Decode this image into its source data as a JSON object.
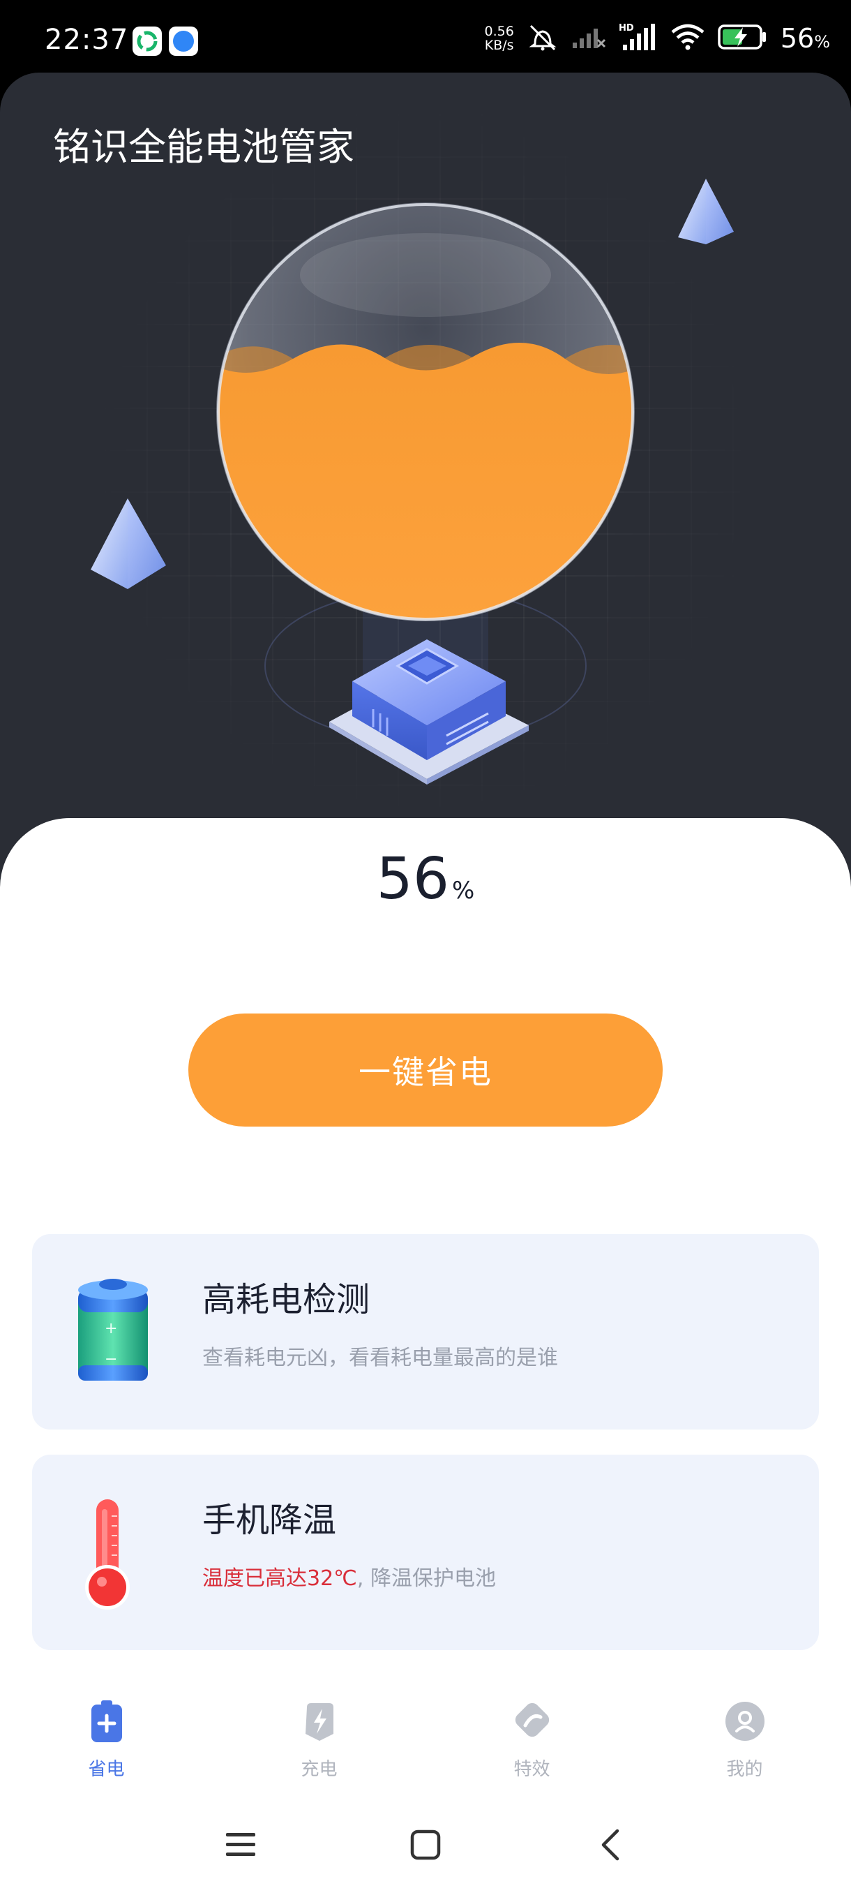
{
  "status_bar": {
    "time": "22:37",
    "net_speed_value": "0.56",
    "net_speed_unit": "KB/s",
    "battery_percent": "56",
    "battery_unit": "%",
    "icons": [
      "app-green-icon",
      "app-blue-compass-icon",
      "mute-icon",
      "signal-off-icon",
      "hd-signal-icon",
      "wifi-icon",
      "battery-charging-icon"
    ]
  },
  "header": {
    "app_title": "铭识全能电池管家"
  },
  "battery_display": {
    "level": 56,
    "value": "56",
    "unit": "%",
    "fill_color": "#fd9f37"
  },
  "actions": {
    "save_power_label": "一键省电",
    "accent": "#fd9f37"
  },
  "cards": [
    {
      "icon": "battery-icon",
      "title": "高耗电检测",
      "subtitle": "查看耗电元凶，看看耗电量最高的是谁"
    },
    {
      "icon": "thermometer-icon",
      "title": "手机降温",
      "subtitle_warning": "温度已高达32℃",
      "subtitle_rest": ", 降温保护电池",
      "warning_color": "#d92e3a"
    }
  ],
  "tabbar": {
    "active_color": "#4a76e6",
    "items": [
      {
        "label": "省电",
        "icon": "battery-save-icon",
        "active": true
      },
      {
        "label": "充电",
        "icon": "charge-icon",
        "active": false
      },
      {
        "label": "特效",
        "icon": "effects-icon",
        "active": false
      },
      {
        "label": "我的",
        "icon": "profile-icon",
        "active": false
      }
    ]
  },
  "system_nav": [
    "menu-icon",
    "home-icon",
    "back-icon"
  ]
}
